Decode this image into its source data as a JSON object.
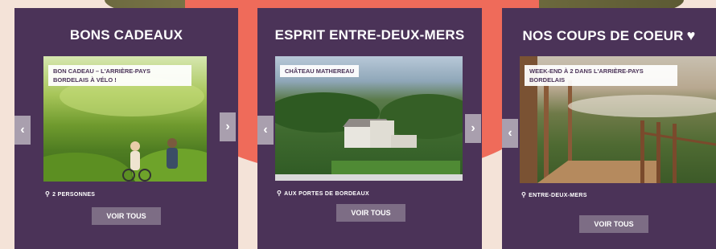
{
  "cards": [
    {
      "title": "BONS CADEAUX",
      "caption": "BON CADEAU – L'ARRIÈRE-PAYS BORDELAIS À VÉLO !",
      "location": "2 PERSONNES",
      "button": "VOIR TOUS",
      "image_icon": "cyclists-photo"
    },
    {
      "title": "ESPRIT ENTRE-DEUX-MERS",
      "caption": "CHÂTEAU MATHEREAU",
      "location": "AUX PORTES DE BORDEAUX",
      "button": "VOIR TOUS",
      "image_icon": "chateau-photo"
    },
    {
      "title": "NOS COUPS DE COEUR",
      "heart": "♥",
      "caption": "WEEK-END À 2 DANS L'ARRIÈRE-PAYS BORDELAIS",
      "location": "ENTRE-DEUX-MERS",
      "button": "VOIR TOUS",
      "image_icon": "terrace-view-photo"
    }
  ],
  "icons": {
    "prev": "‹",
    "next": "›",
    "pin": "⚲"
  }
}
